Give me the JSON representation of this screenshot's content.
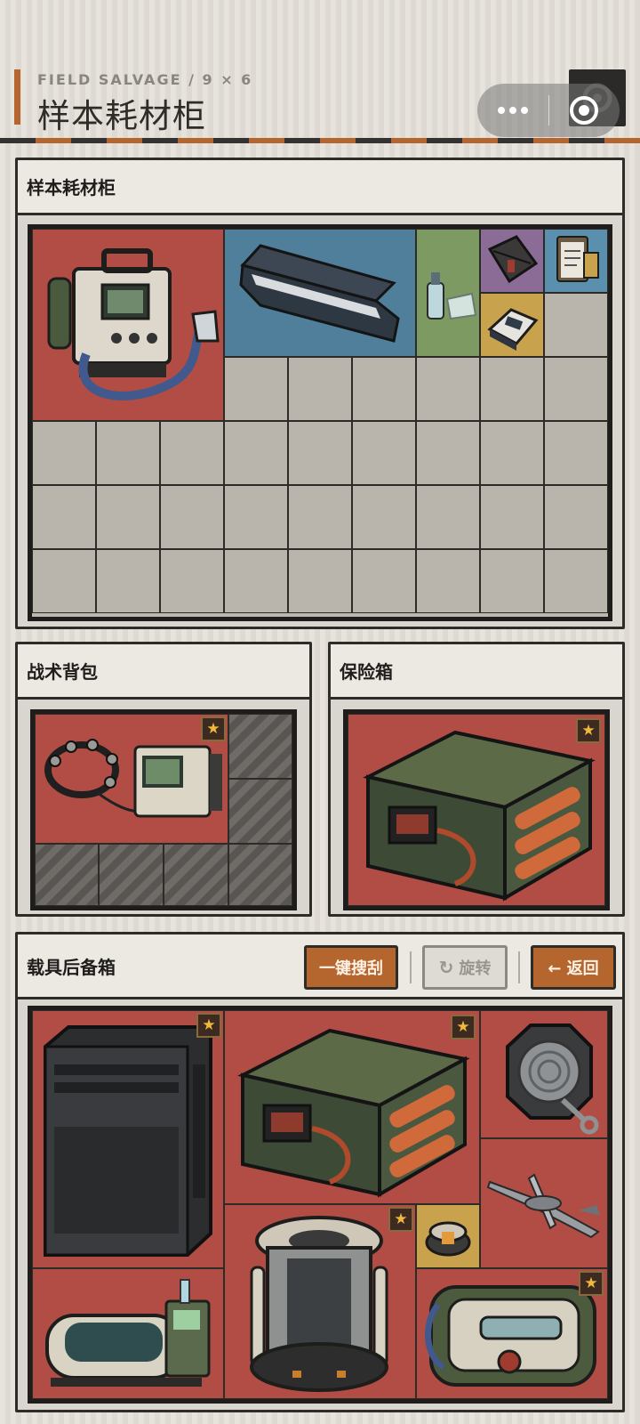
{
  "header": {
    "subtitle": "FIELD SALVAGE / 9 × 6",
    "title": "样本耗材柜"
  },
  "colors": {
    "accent": "#b5652e",
    "item_red": "#b14d45",
    "item_blue": "#4f7f9b",
    "item_green": "#7d9a63",
    "item_purple": "#8b6c97",
    "item_gold": "#c9a24e",
    "item_steelblue": "#5b8fae",
    "cell_empty": "#b9b4ac",
    "star": "#f0b93a"
  },
  "cabinet": {
    "title": "样本耗材柜",
    "columns": 9,
    "rows": 6,
    "items": [
      {
        "name": "portable-ventilator",
        "icon": "ventilator-icon",
        "color": "red"
      },
      {
        "name": "stretcher-case",
        "icon": "stretcher-case-icon",
        "color": "blue"
      },
      {
        "name": "spray-bottle",
        "icon": "spray-bottle-icon",
        "color": "green"
      },
      {
        "name": "tool-pouch",
        "icon": "pouch-icon",
        "color": "purple"
      },
      {
        "name": "clipboard",
        "icon": "clipboard-icon",
        "color": "steelblue"
      },
      {
        "name": "pulse-oximeter",
        "icon": "pulse-oximeter-icon",
        "color": "gold"
      }
    ]
  },
  "backpack": {
    "title": "战术背包",
    "items": [
      {
        "name": "neural-headset-monitor",
        "icon": "eeg-monitor-icon",
        "color": "red",
        "starred": true
      }
    ]
  },
  "safe": {
    "title": "保险箱",
    "items": [
      {
        "name": "battery-pack",
        "icon": "battery-pack-icon",
        "color": "red",
        "starred": true
      }
    ]
  },
  "trunk": {
    "title": "载具后备箱",
    "buttons": {
      "loot_all": "一键搜刮",
      "rotate": "旋转",
      "back": "← 返回"
    },
    "items": [
      {
        "name": "server-tower",
        "icon": "server-tower-icon",
        "color": "red",
        "starred": true
      },
      {
        "name": "battery-pack",
        "icon": "battery-pack-icon",
        "color": "red",
        "starred": true
      },
      {
        "name": "cable-reel",
        "icon": "cable-reel-icon",
        "color": "red",
        "starred": false
      },
      {
        "name": "recon-drone",
        "icon": "drone-icon",
        "color": "red",
        "starred": false
      },
      {
        "name": "medical-pod",
        "icon": "medical-pod-icon",
        "color": "red",
        "starred": false
      },
      {
        "name": "reactor-core",
        "icon": "reactor-core-icon",
        "color": "red",
        "starred": true
      },
      {
        "name": "small-core",
        "icon": "small-core-icon",
        "color": "gold",
        "starred": false
      },
      {
        "name": "cryo-capsule",
        "icon": "cryo-capsule-icon",
        "color": "red",
        "starred": true
      }
    ]
  }
}
